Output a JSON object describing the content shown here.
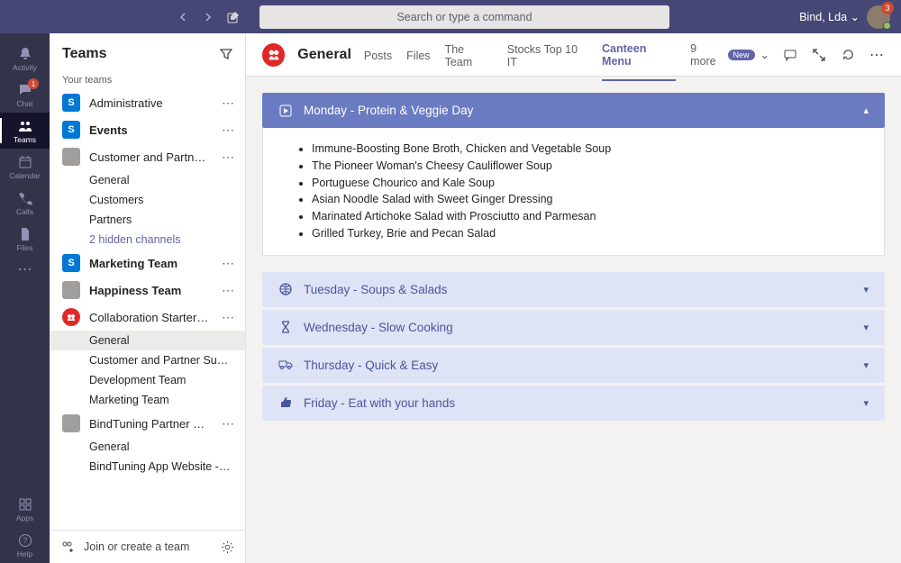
{
  "topbar": {
    "search_placeholder": "Search or type a command",
    "user_name": "Bind, Lda",
    "badge_count": "3"
  },
  "rail": {
    "items": [
      {
        "id": "activity",
        "label": "Activity",
        "icon": "bell"
      },
      {
        "id": "chat",
        "label": "Chat",
        "icon": "chat",
        "badge": "1"
      },
      {
        "id": "teams",
        "label": "Teams",
        "icon": "teams",
        "active": true
      },
      {
        "id": "calendar",
        "label": "Calendar",
        "icon": "calendar"
      },
      {
        "id": "calls",
        "label": "Calls",
        "icon": "calls"
      },
      {
        "id": "files",
        "label": "Files",
        "icon": "files"
      }
    ],
    "bottom": [
      {
        "id": "apps",
        "label": "Apps",
        "icon": "apps"
      },
      {
        "id": "help",
        "label": "Help",
        "icon": "help"
      }
    ]
  },
  "sidebar": {
    "title": "Teams",
    "section_label": "Your teams",
    "teams": [
      {
        "name": "Administrative",
        "bold": false,
        "avatar": "s"
      },
      {
        "name": "Events",
        "bold": true,
        "avatar": "s"
      },
      {
        "name": "Customer and Partner Su…",
        "bold": false,
        "avatar": "img",
        "channels": [
          "General",
          "Customers",
          "Partners"
        ],
        "hidden_link": "2 hidden channels"
      },
      {
        "name": "Marketing Team",
        "bold": true,
        "avatar": "s"
      },
      {
        "name": "Happiness Team",
        "bold": true,
        "avatar": "img"
      },
      {
        "name": "Collaboration Starter Kit",
        "bold": false,
        "avatar": "kit",
        "channels": [
          "General",
          "Customer and Partner Success",
          "Development Team",
          "Marketing Team"
        ],
        "current": "General"
      },
      {
        "name": "BindTuning Partner Cent…",
        "bold": false,
        "avatar": "img",
        "channels": [
          "General",
          "BindTuning App Website - Excl…"
        ]
      }
    ],
    "footer": {
      "join": "Join or create a team"
    }
  },
  "channel": {
    "name": "General",
    "tabs": [
      "Posts",
      "Files",
      "The Team",
      "Stocks Top 10 IT",
      "Canteen Menu"
    ],
    "active_tab": "Canteen Menu",
    "more": "9 more",
    "new_label": "New"
  },
  "menu": {
    "days": [
      {
        "title": "Monday - Protein & Veggie Day",
        "icon": "play",
        "open": true,
        "items": [
          "Immune-Boosting Bone Broth, Chicken and Vegetable Soup",
          "The Pioneer Woman's Cheesy Cauliflower Soup",
          "Portuguese Chourico and Kale Soup",
          "Asian Noodle Salad with Sweet Ginger Dressing",
          "Marinated Artichoke Salad with Prosciutto and Parmesan",
          "Grilled Turkey, Brie and Pecan Salad"
        ]
      },
      {
        "title": "Tuesday - Soups & Salads",
        "icon": "ball"
      },
      {
        "title": "Wednesday - Slow Cooking",
        "icon": "hourglass"
      },
      {
        "title": "Thursday - Quick & Easy",
        "icon": "truck"
      },
      {
        "title": "Friday - Eat with your hands",
        "icon": "thumb"
      }
    ]
  }
}
